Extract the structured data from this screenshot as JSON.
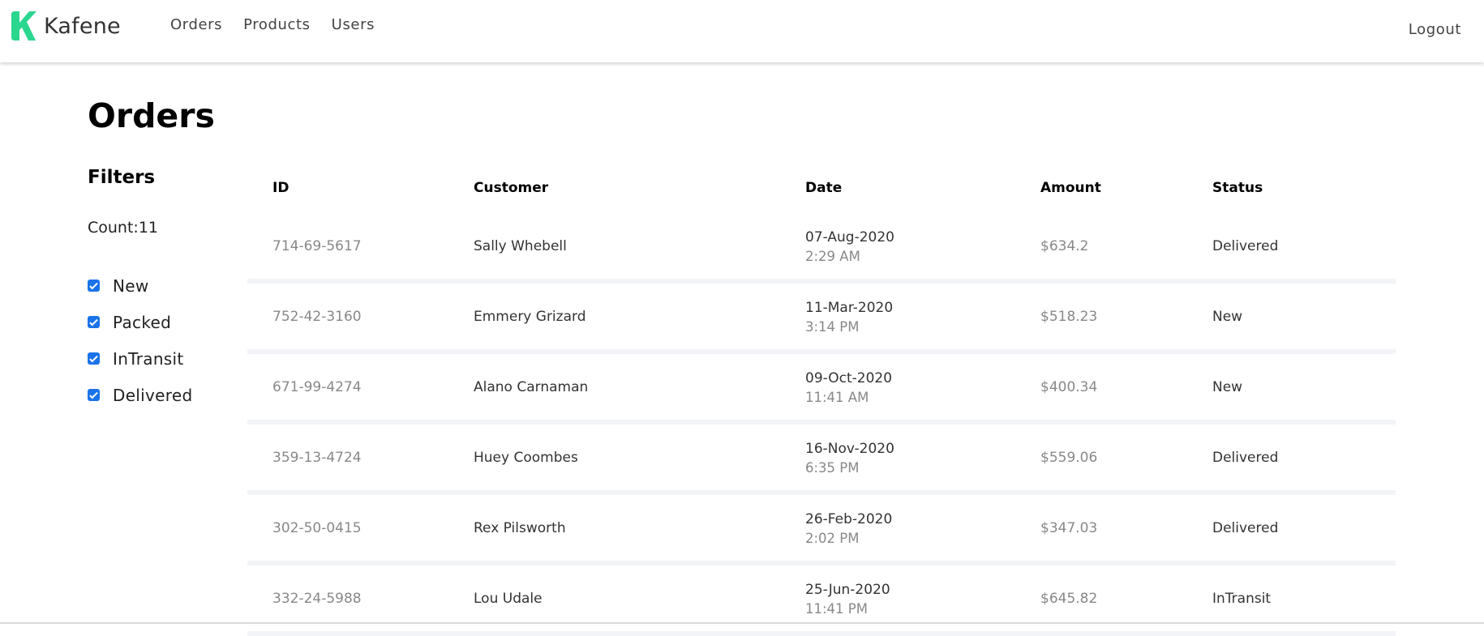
{
  "brand": {
    "name": "Kafene",
    "accent_color": "#2bd68f"
  },
  "nav": {
    "links": [
      "Orders",
      "Products",
      "Users"
    ],
    "logout": "Logout"
  },
  "page": {
    "title": "Orders"
  },
  "filters": {
    "heading": "Filters",
    "count": "Count:11",
    "items": [
      {
        "label": "New",
        "checked": true
      },
      {
        "label": "Packed",
        "checked": true
      },
      {
        "label": "InTransit",
        "checked": true
      },
      {
        "label": "Delivered",
        "checked": true
      }
    ]
  },
  "table": {
    "columns": [
      "ID",
      "Customer",
      "Date",
      "Amount",
      "Status"
    ],
    "rows": [
      {
        "id": "714-69-5617",
        "customer": "Sally Whebell",
        "date": "07-Aug-2020",
        "time": "2:29 AM",
        "amount": "$634.2",
        "status": "Delivered"
      },
      {
        "id": "752-42-3160",
        "customer": "Emmery Grizard",
        "date": "11-Mar-2020",
        "time": "3:14 PM",
        "amount": "$518.23",
        "status": "New"
      },
      {
        "id": "671-99-4274",
        "customer": "Alano Carnaman",
        "date": "09-Oct-2020",
        "time": "11:41 AM",
        "amount": "$400.34",
        "status": "New"
      },
      {
        "id": "359-13-4724",
        "customer": "Huey Coombes",
        "date": "16-Nov-2020",
        "time": "6:35 PM",
        "amount": "$559.06",
        "status": "Delivered"
      },
      {
        "id": "302-50-0415",
        "customer": "Rex Pilsworth",
        "date": "26-Feb-2020",
        "time": "2:02 PM",
        "amount": "$347.03",
        "status": "Delivered"
      },
      {
        "id": "332-24-5988",
        "customer": "Lou Udale",
        "date": "25-Jun-2020",
        "time": "11:41 PM",
        "amount": "$645.82",
        "status": "InTransit"
      }
    ]
  }
}
